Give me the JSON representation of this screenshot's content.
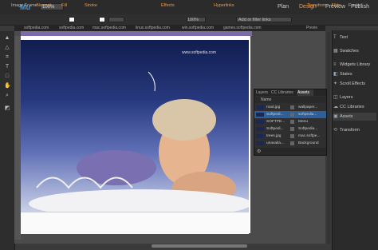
{
  "app": {
    "logo": "Mu",
    "zoom": "100%"
  },
  "top_tabs": [
    "Plan",
    "Design",
    "Preview",
    "Publish"
  ],
  "control_bar": {
    "image_frame_label": "Image Frame:",
    "image_frame_value": "Normal",
    "fill_label": "Fill",
    "stroke_label": "Stroke",
    "effects_label": "Effects",
    "opacity": "100%",
    "hyperlinks_label": "Hyperlinks",
    "hyperlink_placeholder": "Add or filter links",
    "transform_label": "Transform",
    "align_label": "Align",
    "footer_label": "Footer"
  },
  "doc_tabs": [
    "softpedia.com",
    "softpedia.com",
    "mac.softpedia.com",
    "linux.softpedia.com",
    "win.softpedia.com",
    "games.softpedia.com",
    "Previe"
  ],
  "canvas": {
    "copyright": "www.softpedia.com"
  },
  "right_panel": [
    {
      "icon": "T",
      "label": "Text"
    },
    {
      "icon": "▦",
      "label": "Swatches"
    },
    {
      "icon": "≡",
      "label": "Widgets Library"
    },
    {
      "icon": "◧",
      "label": "States"
    },
    {
      "icon": "✦",
      "label": "Scroll Effects"
    },
    {
      "icon": "◫",
      "label": "Layers"
    },
    {
      "icon": "☁",
      "label": "CC Libraries"
    },
    {
      "icon": "▣",
      "label": "Assets"
    },
    {
      "icon": "⟲",
      "label": "Transform"
    }
  ],
  "assets_panel": {
    "tabs": [
      "Layers",
      "CC Libraries",
      "Assets"
    ],
    "column": "Name",
    "rows": [
      {
        "name": "road.jpg",
        "location": "wallpaper..."
      },
      {
        "name": "Softpedi...",
        "location": "softpedia..."
      },
      {
        "name": "SOFTPE...",
        "location": "Menu"
      },
      {
        "name": "Softpedi...",
        "location": "Softpedia..."
      },
      {
        "name": "trees.jpg",
        "location": "mac.softpe..."
      },
      {
        "name": "unavaila...",
        "location": "Background"
      }
    ]
  },
  "colors": {
    "accent": "#f29a3a",
    "selection": "#2f5f98"
  }
}
